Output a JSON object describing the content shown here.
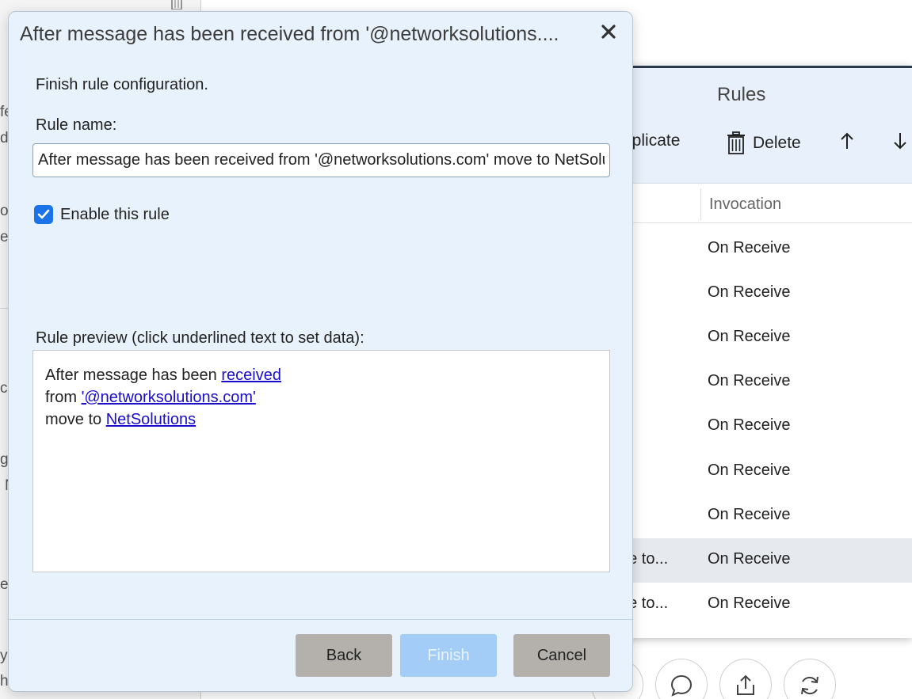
{
  "background": {
    "left_fragments": [
      "fe",
      "d-",
      "or",
      "e",
      "c",
      "g",
      "N",
      "ec",
      "y",
      "h"
    ]
  },
  "rules_window": {
    "title": "Rules",
    "toolbar": {
      "duplicate_label": "uplicate",
      "delete_label": "Delete",
      "move_up_icon": "arrow-up-icon",
      "move_down_icon": "arrow-down-icon"
    },
    "columns": {
      "invocation": "Invocation"
    },
    "rows": [
      {
        "name": "",
        "invocation": "On Receive"
      },
      {
        "name": "",
        "invocation": "On Receive"
      },
      {
        "name": "",
        "invocation": "On Receive"
      },
      {
        "name": "",
        "invocation": "On Receive"
      },
      {
        "name": "",
        "invocation": "On Receive"
      },
      {
        "name": "",
        "invocation": "On Receive"
      },
      {
        "name": "",
        "invocation": "On Receive"
      },
      {
        "name": "ove to...",
        "invocation": "On Receive",
        "selected": true
      },
      {
        "name": "ove to...",
        "invocation": "On Receive"
      }
    ]
  },
  "dialog": {
    "title": "After message has been received from '@networksolutions....",
    "intro": "Finish rule configuration.",
    "rule_name_label": "Rule name:",
    "rule_name_value": "After message has been received from '@networksolutions.com' move to NetSolutions",
    "enable_label": "Enable this rule",
    "enabled": true,
    "preview_label": "Rule preview (click underlined text to set data):",
    "preview": {
      "line1_text": "After message has been ",
      "line1_link": "received",
      "line2_text": "from ",
      "line2_link": "'@networksolutions.com'",
      "line3_text": "move to ",
      "line3_link": "NetSolutions"
    },
    "buttons": {
      "back": "Back",
      "finish": "Finish",
      "cancel": "Cancel"
    }
  },
  "bottom_actions": [
    "chat-icon",
    "share-icon",
    "refresh-icon"
  ]
}
